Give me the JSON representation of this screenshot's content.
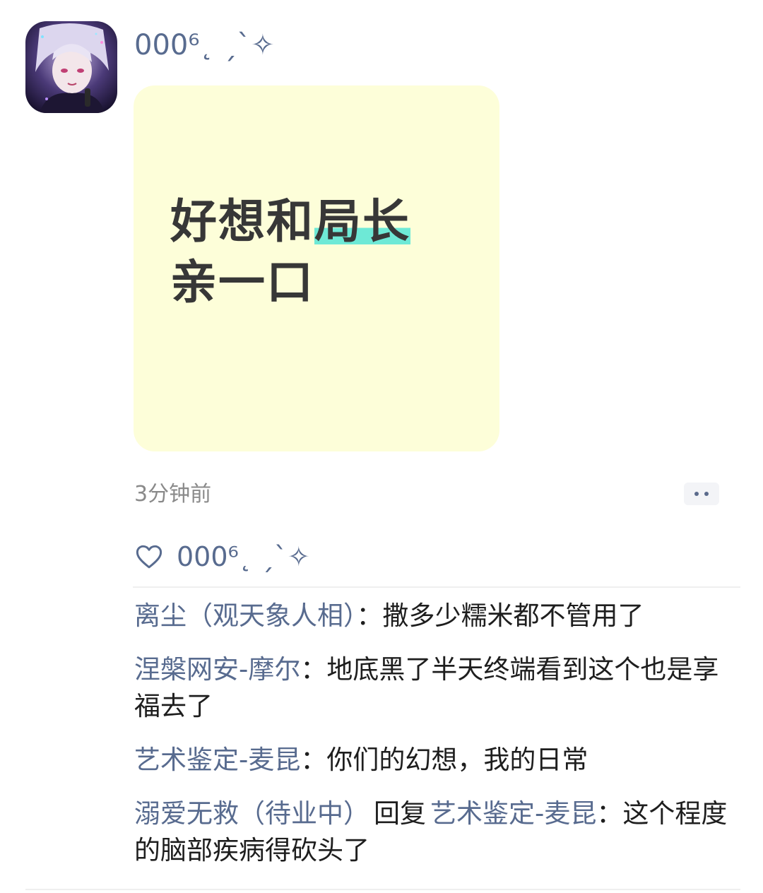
{
  "post": {
    "username": "000⁶˛ ˏˋ✧",
    "content_line1_plain": "好想和",
    "content_line1_highlight": "局长",
    "content_line2": "亲一口",
    "timestamp": "3分钟前",
    "card_color": "#fdfed9",
    "highlight_color": "#6ee9d6"
  },
  "likes": {
    "icon": "heart-icon",
    "liker": "000⁶˛ ˏˋ✧"
  },
  "comments": [
    {
      "author": "离尘（观天象人相）",
      "separator": "：",
      "text": "撒多少糯米都不管用了"
    },
    {
      "author": "涅槃网安-摩尔",
      "separator": "：",
      "text": "地底黑了半天终端看到这个也是享福去了"
    },
    {
      "author": "艺术鉴定-麦昆",
      "separator": "：",
      "text": "你们的幻想，我的日常"
    },
    {
      "author": "溺爱无救（待业中）",
      "reply_word": "回复",
      "reply_to": "艺术鉴定-麦昆",
      "separator": "：",
      "text": "这个程度的脑部疾病得砍头了"
    }
  ],
  "colors": {
    "name_color": "#586b8f",
    "text_color": "#1e1e1e"
  }
}
